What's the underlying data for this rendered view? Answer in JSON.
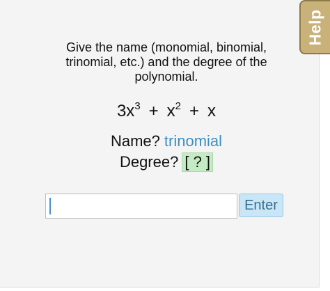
{
  "help": {
    "label": "Help"
  },
  "question": {
    "prompt": "Give the name (monomial, binomial, trinomial, etc.) and the degree of the polynomial."
  },
  "polynomial": {
    "term1_base": "3x",
    "term1_exp": "3",
    "op1": "+",
    "term2_base": "x",
    "term2_exp": "2",
    "op2": "+",
    "term3": "x"
  },
  "name_line": {
    "label": "Name?",
    "value": "trinomial"
  },
  "degree_line": {
    "label": "Degree?",
    "placeholder": "[ ? ]"
  },
  "answer": {
    "value": ""
  },
  "enter_button": {
    "label": "Enter"
  },
  "colors": {
    "help_tab": "#c8b27a",
    "name_value": "#3d8fc4",
    "degree_box": "#c4ebc4",
    "enter_button": "#c8e6f6"
  }
}
